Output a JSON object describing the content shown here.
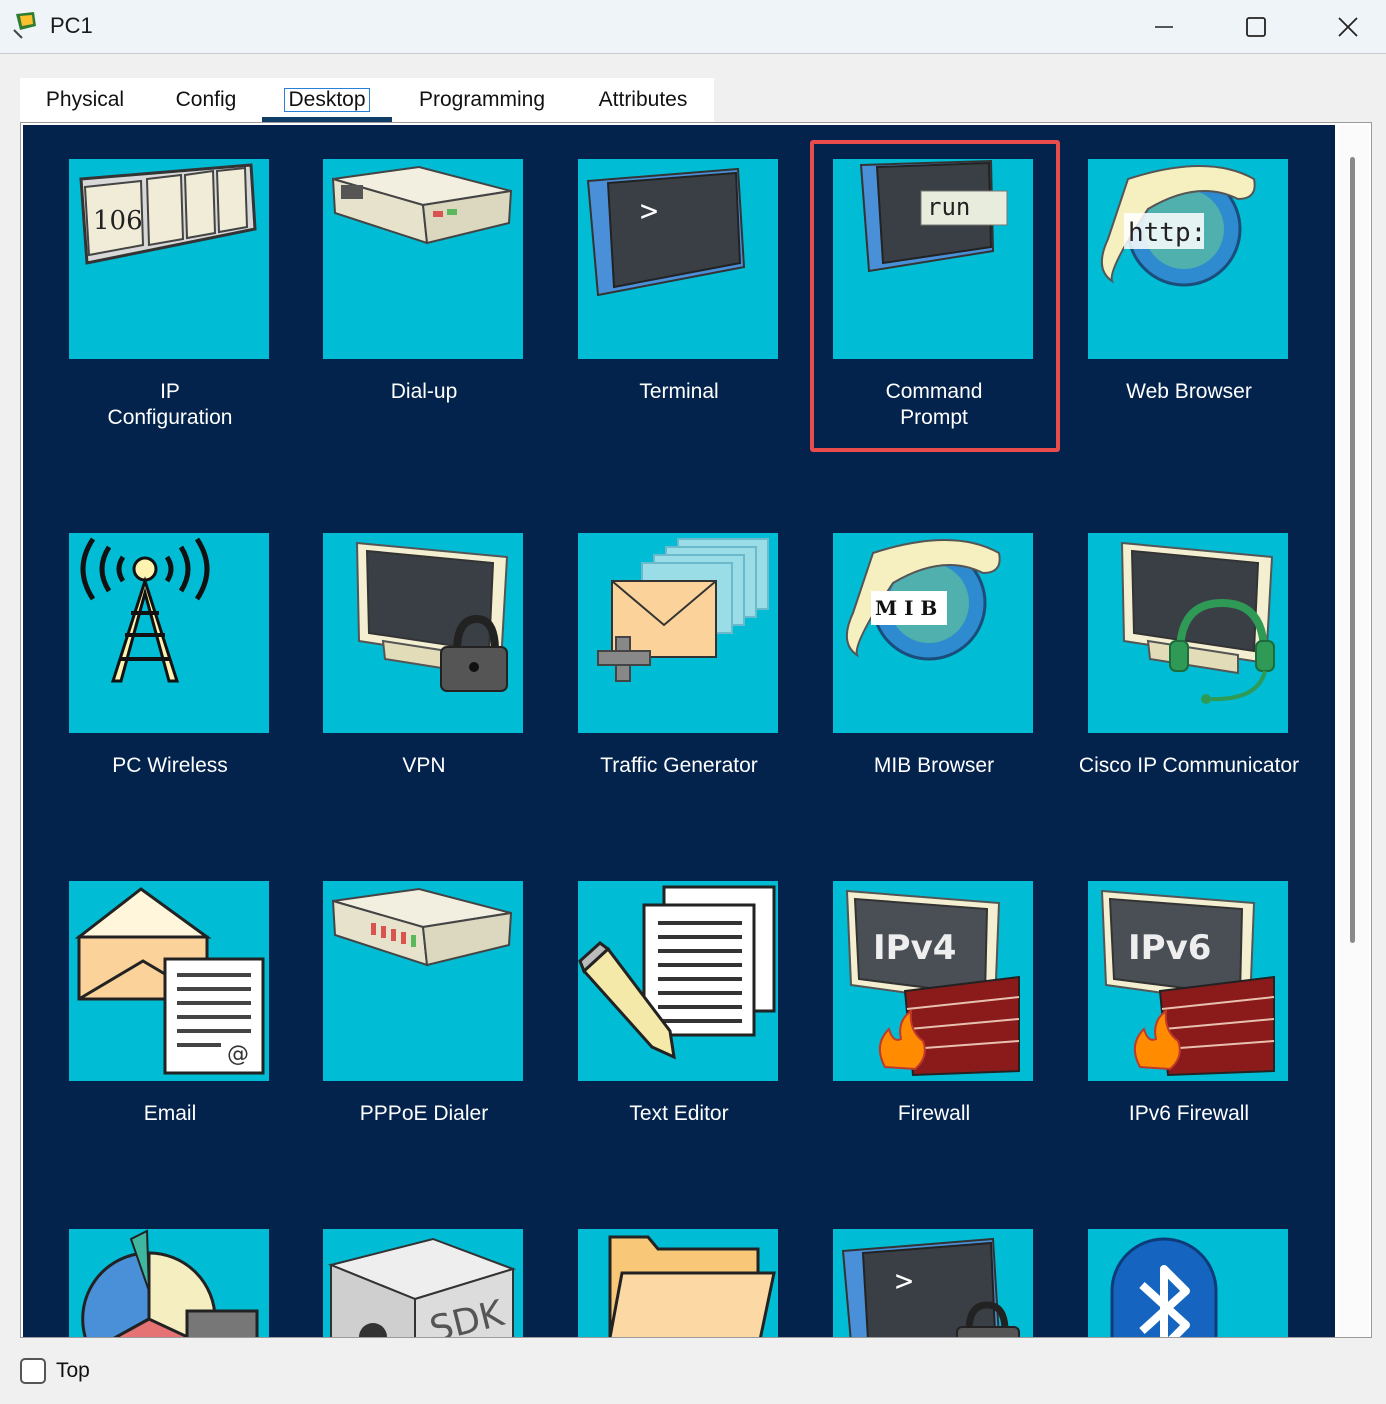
{
  "window": {
    "title": "PC1"
  },
  "tabs": [
    {
      "label": "Physical"
    },
    {
      "label": "Config"
    },
    {
      "label": "Desktop",
      "active": true
    },
    {
      "label": "Programming"
    },
    {
      "label": "Attributes"
    }
  ],
  "apps": [
    {
      "label": "IP\nConfiguration",
      "icon": "ip-config-icon",
      "badge": "106"
    },
    {
      "label": "Dial-up",
      "icon": "modem-icon"
    },
    {
      "label": "Terminal",
      "icon": "terminal-icon",
      "badge": ">"
    },
    {
      "label": "Command\nPrompt",
      "icon": "command-prompt-icon",
      "badge": "run",
      "highlighted": true
    },
    {
      "label": "Web Browser",
      "icon": "web-browser-icon",
      "badge": "http:"
    },
    {
      "label": "PC Wireless",
      "icon": "wireless-tower-icon"
    },
    {
      "label": "VPN",
      "icon": "vpn-lock-icon"
    },
    {
      "label": "Traffic Generator",
      "icon": "traffic-generator-icon"
    },
    {
      "label": "MIB Browser",
      "icon": "mib-browser-icon",
      "badge": "M I B"
    },
    {
      "label": "Cisco IP Communicator",
      "icon": "headset-monitor-icon"
    },
    {
      "label": "Email",
      "icon": "email-icon"
    },
    {
      "label": "PPPoE Dialer",
      "icon": "pppoe-dialer-icon"
    },
    {
      "label": "Text Editor",
      "icon": "text-editor-icon"
    },
    {
      "label": "Firewall",
      "icon": "firewall-icon",
      "badge": "IPv4"
    },
    {
      "label": "IPv6 Firewall",
      "icon": "firewall-v6-icon",
      "badge": "IPv6"
    },
    {
      "label": "",
      "icon": "netflow-chart-icon"
    },
    {
      "label": "",
      "icon": "sdk-box-icon",
      "badge": "SDK"
    },
    {
      "label": "",
      "icon": "folder-icon"
    },
    {
      "label": "",
      "icon": "ssh-terminal-icon",
      "badge": ">"
    },
    {
      "label": "",
      "icon": "bluetooth-icon"
    }
  ],
  "footer": {
    "top_checkbox_label": "Top",
    "top_checked": false
  },
  "colors": {
    "desktop_bg": "#03234c",
    "tile_bg": "#00bcd4",
    "highlight": "#e84c4c",
    "tab_underline": "#0f3d66"
  }
}
